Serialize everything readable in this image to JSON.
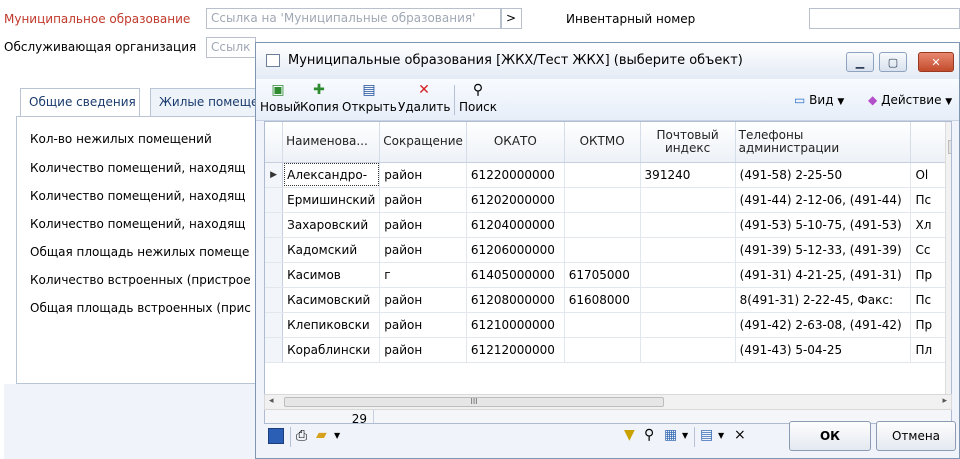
{
  "form": {
    "municipality_label": "Муниципальное образование",
    "municipality_placeholder": "Ссылка на 'Муниципальные образования'",
    "inventory_label": "Инвентарный номер",
    "service_org_label": "Обслуживающая организация",
    "service_org_placeholder": "Ссылк",
    "tabs": [
      "Общие сведения",
      "Жилые помеще"
    ],
    "rows": [
      "Кол-во нежилых помещений",
      "Количество помещений, находящ",
      "Количество помещений, находящ",
      "Количество помещений, находящ",
      "Общая площадь нежилых помеще",
      "Количество встроенных (пристрое",
      "Общая площадь встроенных (прис"
    ]
  },
  "dialog": {
    "title": "Муниципальные образования [ЖКХ/Тест ЖКХ] (выберите объект)",
    "toolbar": {
      "new": "Новый",
      "copy": "Копия",
      "open": "Открыть",
      "delete": "Удалить",
      "search": "Поиск",
      "view": "Вид",
      "action": "Действие"
    },
    "columns": [
      "Наименова...",
      "Сокращение",
      "ОКАТО",
      "ОКТМО",
      "Почтовый индекс",
      "Телефоны администрации",
      ""
    ],
    "rows": [
      [
        "Александро-",
        "район",
        "61220000000",
        "",
        "391240",
        "(491-58) 2-25-50",
        "Ol"
      ],
      [
        "Ермишинский",
        "район",
        "61202000000",
        "",
        "",
        "(491-44) 2-12-06, (491-44)",
        "Пс"
      ],
      [
        "Захаровский",
        "район",
        "61204000000",
        "",
        "",
        "(491-53) 5-10-75, (491-53)",
        "Хл"
      ],
      [
        "Кадомский",
        "район",
        "61206000000",
        "",
        "",
        "(491-39) 5-12-33, (491-39)",
        "Сс"
      ],
      [
        "Касимов",
        "г",
        "61405000000",
        "61705000",
        "",
        "(491-31) 4-21-25, (491-31)",
        "Пр"
      ],
      [
        "Касимовский",
        "район",
        "61208000000",
        "61608000",
        "",
        "8(491-31) 2-22-45, Факс:",
        "Пс"
      ],
      [
        "Клепиковски",
        "район",
        "61210000000",
        "",
        "",
        "(491-42) 2-63-08, (491-42)",
        "Пр"
      ],
      [
        "Кораблински",
        "район",
        "61212000000",
        "",
        "",
        "(491-43) 5-04-25",
        "Пл"
      ]
    ],
    "count": "29",
    "ok": "ОК",
    "cancel": "Отмена",
    "scroll_thumb": "III"
  },
  "colors": {
    "label_red": "#c0392b",
    "close_red": "#c24b2c",
    "delete_red": "#d62020",
    "accent_green": "#2e8b2e"
  }
}
